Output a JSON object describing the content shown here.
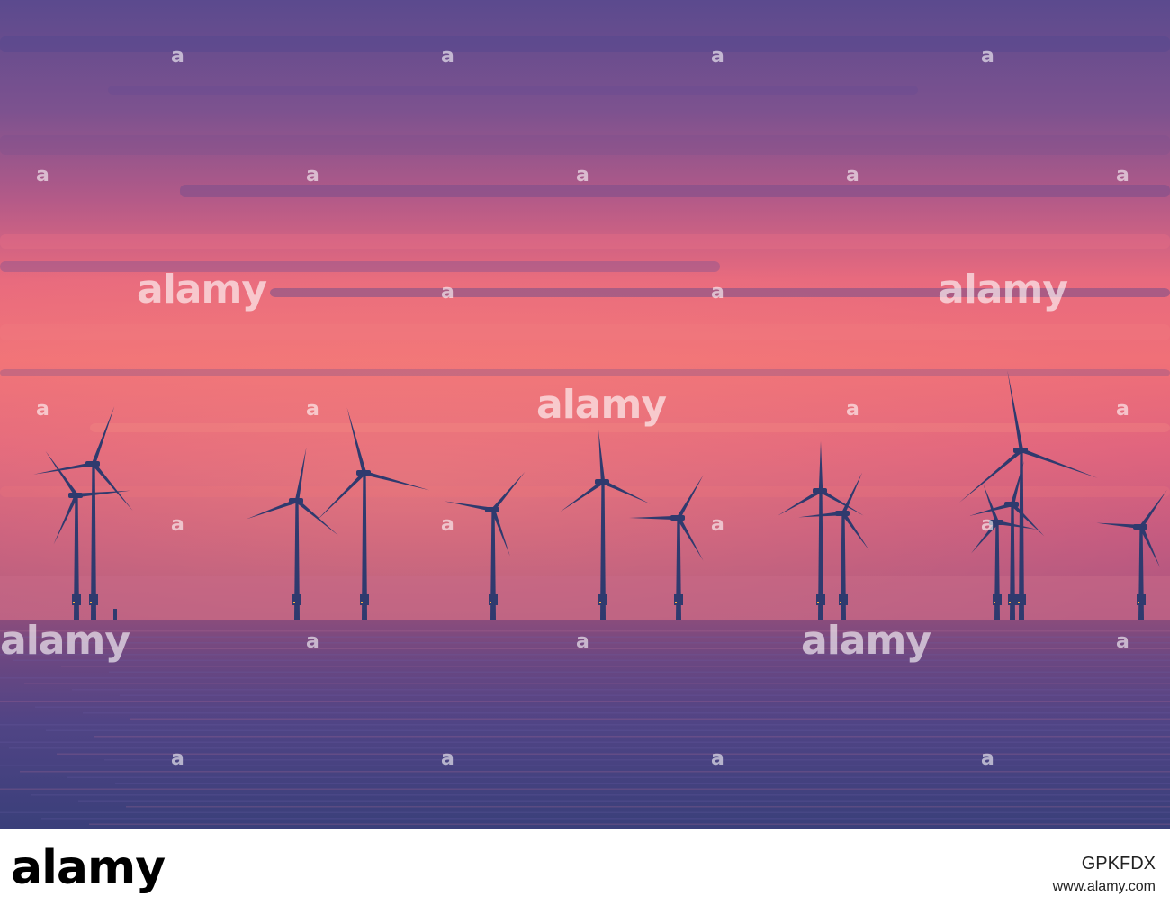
{
  "watermark": {
    "logo_text": "alamy",
    "icon_text": "a"
  },
  "footer": {
    "logo_text": "alamy",
    "image_id": "GPKFDX",
    "url": "www.alamy.com"
  },
  "colors": {
    "sky_top": "#5a4c8e",
    "sky_mid": "#c85a8a",
    "sky_glow": "#f26a6e",
    "horizon": "#c25a7c",
    "sea": "#4a3e7a",
    "turbine": "#2f3a6e"
  }
}
